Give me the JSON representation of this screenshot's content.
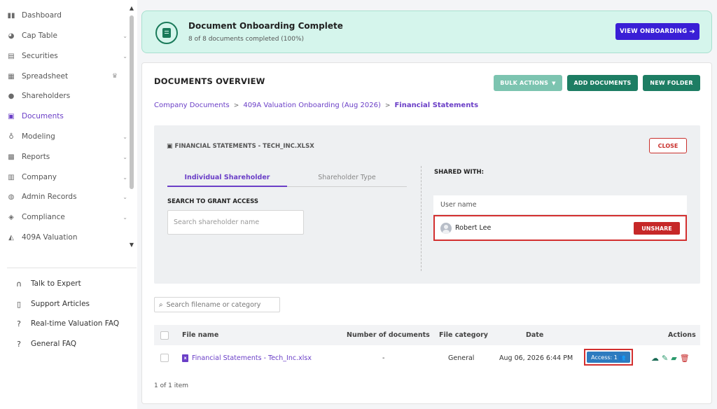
{
  "sidebar": {
    "items": [
      {
        "label": "Dashboard",
        "icon": "dashboard-icon",
        "active": false
      },
      {
        "label": "Cap Table",
        "icon": "pie-chart-icon",
        "active": false
      },
      {
        "label": "Securities",
        "icon": "clipboard-icon",
        "active": false
      },
      {
        "label": "Spreadsheet",
        "icon": "grid-icon",
        "active": false
      },
      {
        "label": "Shareholders",
        "icon": "user-icon",
        "active": false
      },
      {
        "label": "Documents",
        "icon": "folder-icon",
        "active": true
      },
      {
        "label": "Modeling",
        "icon": "bulb-icon",
        "active": false
      },
      {
        "label": "Reports",
        "icon": "report-icon",
        "active": false
      },
      {
        "label": "Company",
        "icon": "building-icon",
        "active": false
      },
      {
        "label": "Admin Records",
        "icon": "records-icon",
        "active": false
      },
      {
        "label": "Compliance",
        "icon": "shield-icon",
        "active": false
      },
      {
        "label": "409A Valuation",
        "icon": "valuation-icon",
        "active": false
      }
    ],
    "help": [
      {
        "label": "Talk to Expert",
        "icon": "headset-icon"
      },
      {
        "label": "Support Articles",
        "icon": "book-icon"
      },
      {
        "label": "Real-time Valuation FAQ",
        "icon": "question-icon"
      },
      {
        "label": "General FAQ",
        "icon": "question-icon"
      }
    ]
  },
  "banner": {
    "title": "Document Onboarding Complete",
    "subtitle": "8 of 8 documents completed (100%)",
    "button": "VIEW ONBOARDING"
  },
  "overview": {
    "title": "DOCUMENTS OVERVIEW",
    "bulk_actions": "BULK ACTIONS",
    "add_documents": "ADD DOCUMENTS",
    "new_folder": "NEW FOLDER",
    "breadcrumb": [
      "Company Documents",
      "409A Valuation Onboarding (Aug 2026)",
      "Financial Statements"
    ]
  },
  "share_panel": {
    "file_title": "FINANCIAL STATEMENTS - TECH_INC.XLSX",
    "close": "CLOSE",
    "tabs": [
      "Individual Shareholder",
      "Shareholder Type"
    ],
    "search_label": "SEARCH TO GRANT ACCESS",
    "search_placeholder": "Search shareholder name",
    "shared_with_label": "SHARED WITH:",
    "user_header": "User name",
    "users": [
      {
        "name": "Robert Lee",
        "action": "UNSHARE"
      }
    ]
  },
  "files": {
    "search_placeholder": "Search filename or category",
    "columns": [
      "File name",
      "Number of documents",
      "File category",
      "Date",
      "Actions"
    ],
    "rows": [
      {
        "name": "Financial Statements - Tech_Inc.xlsx",
        "num_docs": "-",
        "category": "General",
        "date": "Aug 06, 2026 6:44 PM",
        "access": "Access: 1"
      }
    ],
    "pagination": "1 of 1 item"
  },
  "colors": {
    "accent_purple": "#6b3fc7",
    "primary_green": "#1d7d63",
    "danger_red": "#c62828",
    "view_button_blue": "#3a1fd6",
    "access_blue": "#2e7bbf",
    "banner_bg": "#d5f5ec"
  }
}
